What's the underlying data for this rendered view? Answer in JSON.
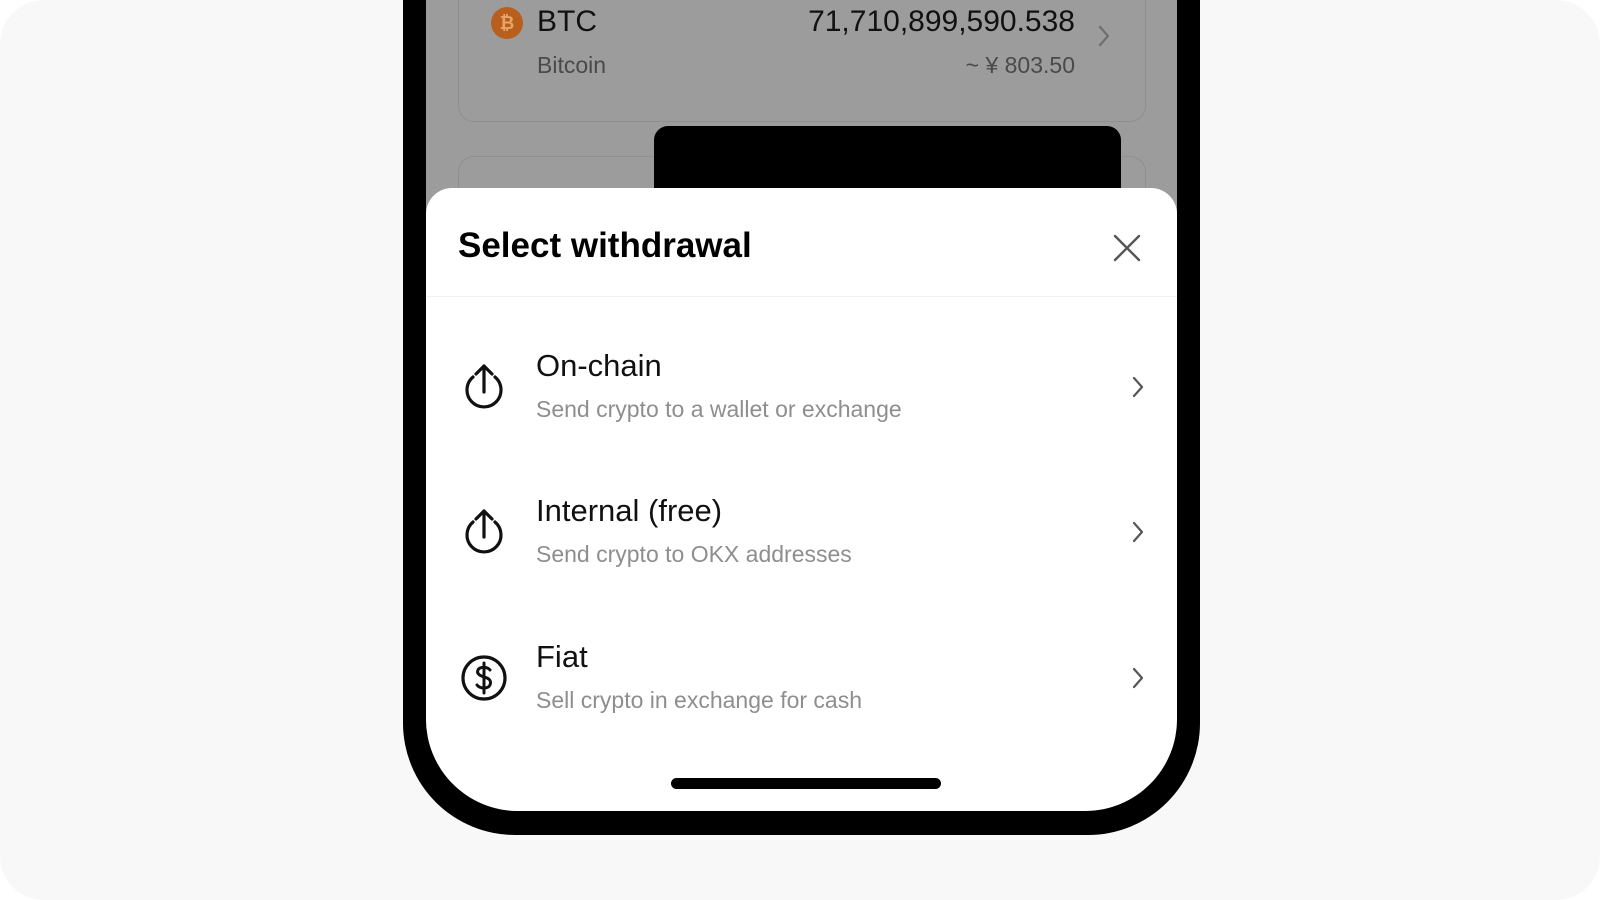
{
  "asset": {
    "symbol": "BTC",
    "name": "Bitcoin",
    "amount": "71,710,899,590.538",
    "fiat_value": "~ ¥ 803.50",
    "icon": "bitcoin-icon"
  },
  "sheet": {
    "title": "Select withdrawal",
    "close_icon": "close-icon",
    "options": [
      {
        "title": "On-chain",
        "subtitle": "Send crypto to a wallet or exchange",
        "icon": "upload-circle-icon"
      },
      {
        "title": "Internal (free)",
        "subtitle": "Send crypto to OKX addresses",
        "icon": "upload-circle-icon"
      },
      {
        "title": "Fiat",
        "subtitle": "Sell crypto in exchange for cash",
        "icon": "dollar-circle-icon"
      }
    ]
  },
  "colors": {
    "overlay": "#9c9c9c",
    "sheet": "#ffffff",
    "subtitle_text": "#8e8e8e",
    "bitcoin_orange": "#b85f1d"
  }
}
